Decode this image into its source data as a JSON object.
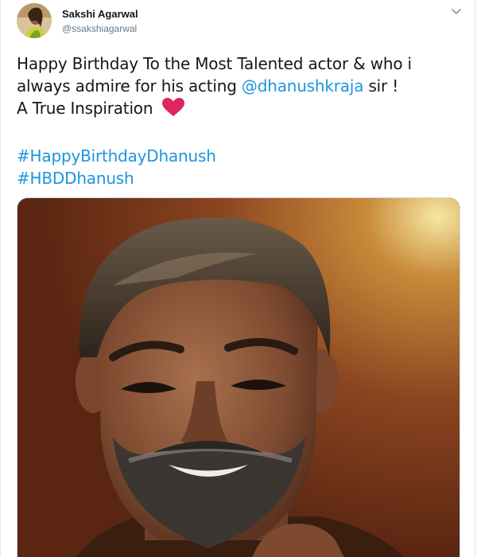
{
  "author": {
    "display_name": "Sakshi Agarwal",
    "handle": "@ssakshiagarwal",
    "avatar_icon": "profile-photo"
  },
  "menu": {
    "icon": "chevron-down-icon"
  },
  "tweet": {
    "line1": "Happy Birthday To the Most Talented actor & who i",
    "line2_prefix": "always admire for his acting ",
    "line2_mention": "@dhanushkraja",
    "line2_suffix": " sir !",
    "line3": "A True Inspiration",
    "emoji": "red-heart-icon",
    "hashtag1": "#HappyBirthdayDhanush",
    "hashtag2": "#HBDDhanush"
  },
  "colors": {
    "link": "#1b95e0",
    "text": "#14171a",
    "secondary": "#657786",
    "heart": "#e0245e"
  },
  "media": {
    "type": "photo"
  }
}
